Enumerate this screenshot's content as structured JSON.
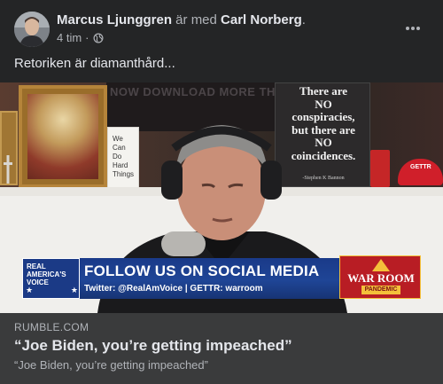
{
  "post": {
    "author": "Marcus Ljunggren",
    "with_text": " är med ",
    "tagged": "Carl Norberg",
    "period": ".",
    "time": "4 tim",
    "time_sep": "·",
    "visibility_icon": "globe-icon",
    "more_icon": "more-horizontal-icon",
    "text": "Retoriken är diamanthård..."
  },
  "media": {
    "screen_text": "NOW DOWNLOAD MORE THAN / OM RE...",
    "card_text": "We\nCan\nDo\nHard\nThings",
    "sign_text": "There are\nNO\nconspiracies,\nbut there are\nNO\ncoincidences.",
    "sign_signature": "-Stephen K Bannon",
    "hat_text": "GETTR",
    "banner": {
      "logo_text": "REAL\nAMERICA'S\nVOICE",
      "stars": "★",
      "title": "FOLLOW US ON SOCIAL MEDIA",
      "subtitle": "Twitter: @RealAmVoice | GETTR: warroom",
      "warroom": "WAR ROOM",
      "pandemic": "PANDEMIC"
    }
  },
  "link": {
    "domain": "RUMBLE.COM",
    "title": "“Joe Biden, you’re getting impeached”",
    "description": "“Joe Biden, you’re getting impeached”"
  }
}
